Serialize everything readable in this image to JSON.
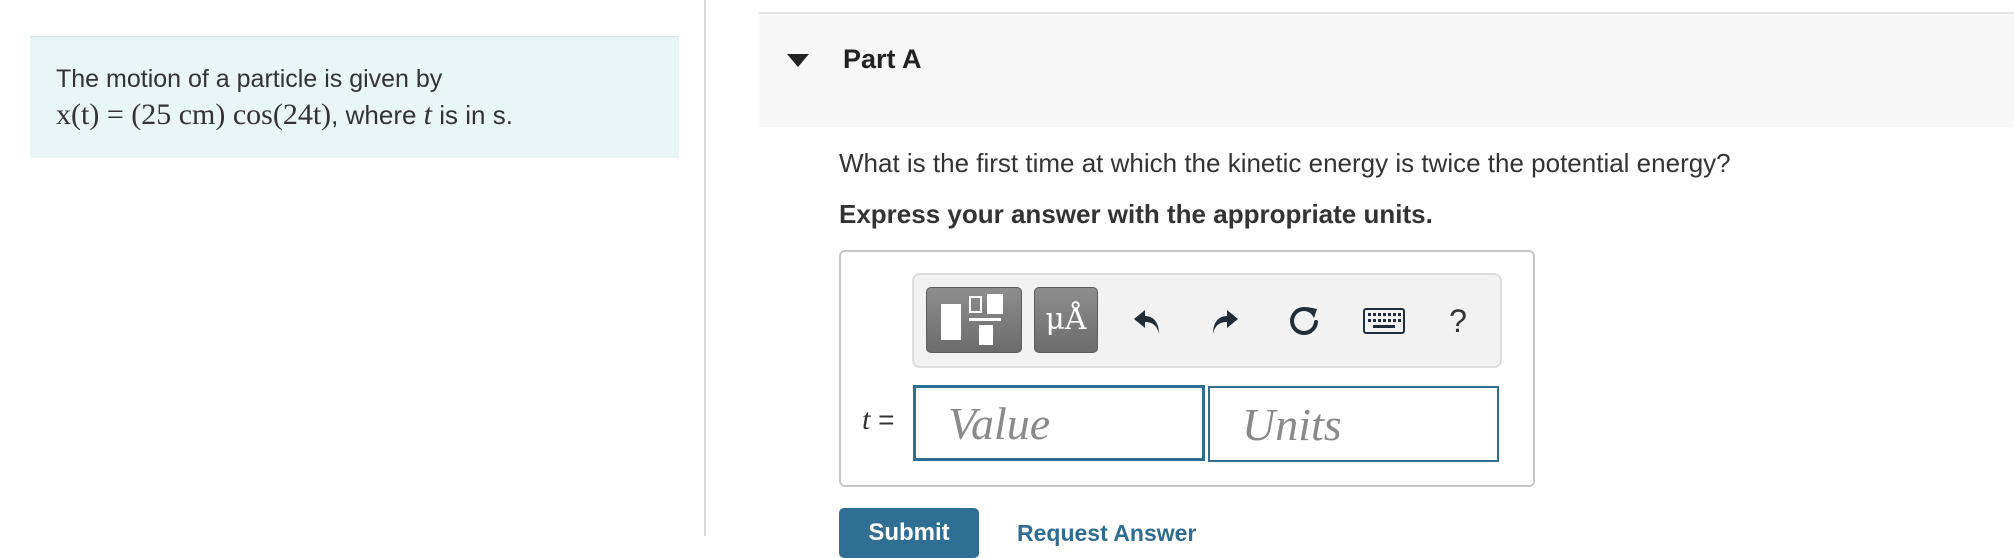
{
  "problem": {
    "line1": "The motion of a particle is given by",
    "equation_lhs": "x(t) = (25 cm) cos(24t)",
    "line2_suffix_text": ", where",
    "var_t": "t",
    "line2_tail": "is in s."
  },
  "part": {
    "title": "Part A",
    "question": "What is the first time at which the kinetic energy is twice the potential energy?",
    "instruction": "Express your answer with the appropriate units."
  },
  "toolbar": {
    "symbols_label": "μÅ",
    "help_label": "?",
    "icons": [
      "templates-icon",
      "symbols-icon",
      "undo-icon",
      "redo-icon",
      "reset-icon",
      "keyboard-icon",
      "help-icon"
    ]
  },
  "answer": {
    "variable": "t",
    "equals": "=",
    "value_placeholder": "Value",
    "units_placeholder": "Units",
    "value": "",
    "units": ""
  },
  "actions": {
    "submit_label": "Submit",
    "request_label": "Request Answer"
  },
  "colors": {
    "problem_bg": "#e9f6f8",
    "accent": "#2f6e92",
    "header_bg": "#f7f7f7"
  }
}
